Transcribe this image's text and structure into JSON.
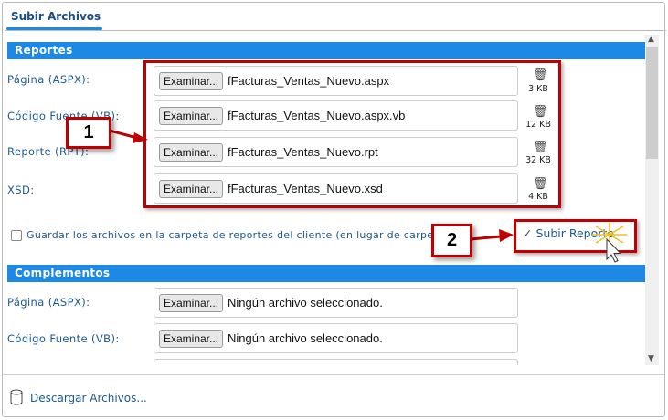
{
  "tab": {
    "label": "Subir Archivos"
  },
  "reportes": {
    "title": "Reportes",
    "rows": [
      {
        "label": "Página (ASPX):",
        "button": "Examinar...",
        "file": "fFacturas_Ventas_Nuevo.aspx",
        "size": "3 KB"
      },
      {
        "label": "Código Fuente (VB):",
        "button": "Examinar...",
        "file": "fFacturas_Ventas_Nuevo.aspx.vb",
        "size": "12 KB"
      },
      {
        "label": "Reporte (RPT):",
        "button": "Examinar...",
        "file": "fFacturas_Ventas_Nuevo.rpt",
        "size": "32 KB"
      },
      {
        "label": "XSD:",
        "button": "Examinar...",
        "file": "fFacturas_Ventas_Nuevo.xsd",
        "size": "4 KB"
      }
    ],
    "checkbox_label": "Guardar los archivos en la carpeta de reportes del cliente (en lugar de carpeta raiz)",
    "checkbox_checked": false,
    "upload_button": "Subir Reporte"
  },
  "complementos": {
    "title": "Complementos",
    "rows": [
      {
        "label": "Página (ASPX):",
        "button": "Examinar...",
        "file": "Ningún archivo seleccionado."
      },
      {
        "label": "Código Fuente (VB):",
        "button": "Examinar...",
        "file": "Ningún archivo seleccionado."
      }
    ]
  },
  "footer": {
    "download_link": "Descargar Archivos..."
  },
  "callouts": [
    "1",
    "2"
  ],
  "colors": {
    "accent": "#1e88e5",
    "label": "#1a5a93",
    "annotation": "#c00000"
  }
}
